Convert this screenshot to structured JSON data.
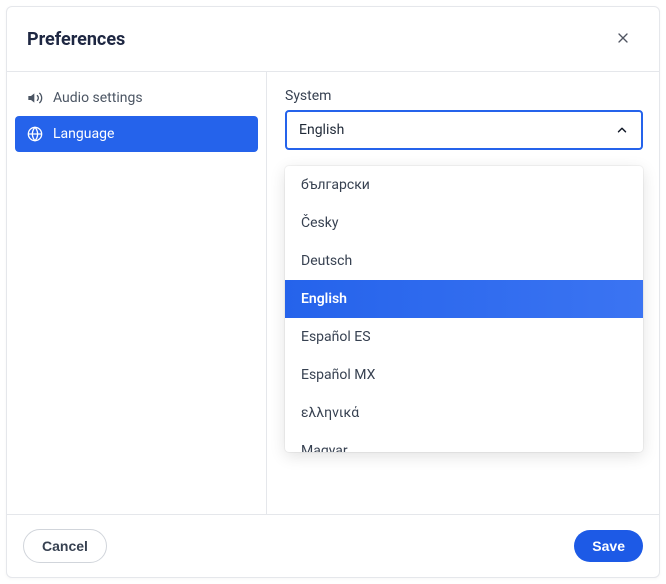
{
  "dialog": {
    "title": "Preferences"
  },
  "sidebar": {
    "items": [
      {
        "label": "Audio settings",
        "active": false
      },
      {
        "label": "Language",
        "active": true
      }
    ]
  },
  "main": {
    "system": {
      "label": "System",
      "selected": "English",
      "options": [
        "български",
        "Česky",
        "Deutsch",
        "English",
        "Español ES",
        "Español MX",
        "ελληνικά",
        "Magyar"
      ],
      "selectedIndex": 3
    }
  },
  "footer": {
    "cancel": "Cancel",
    "save": "Save"
  }
}
